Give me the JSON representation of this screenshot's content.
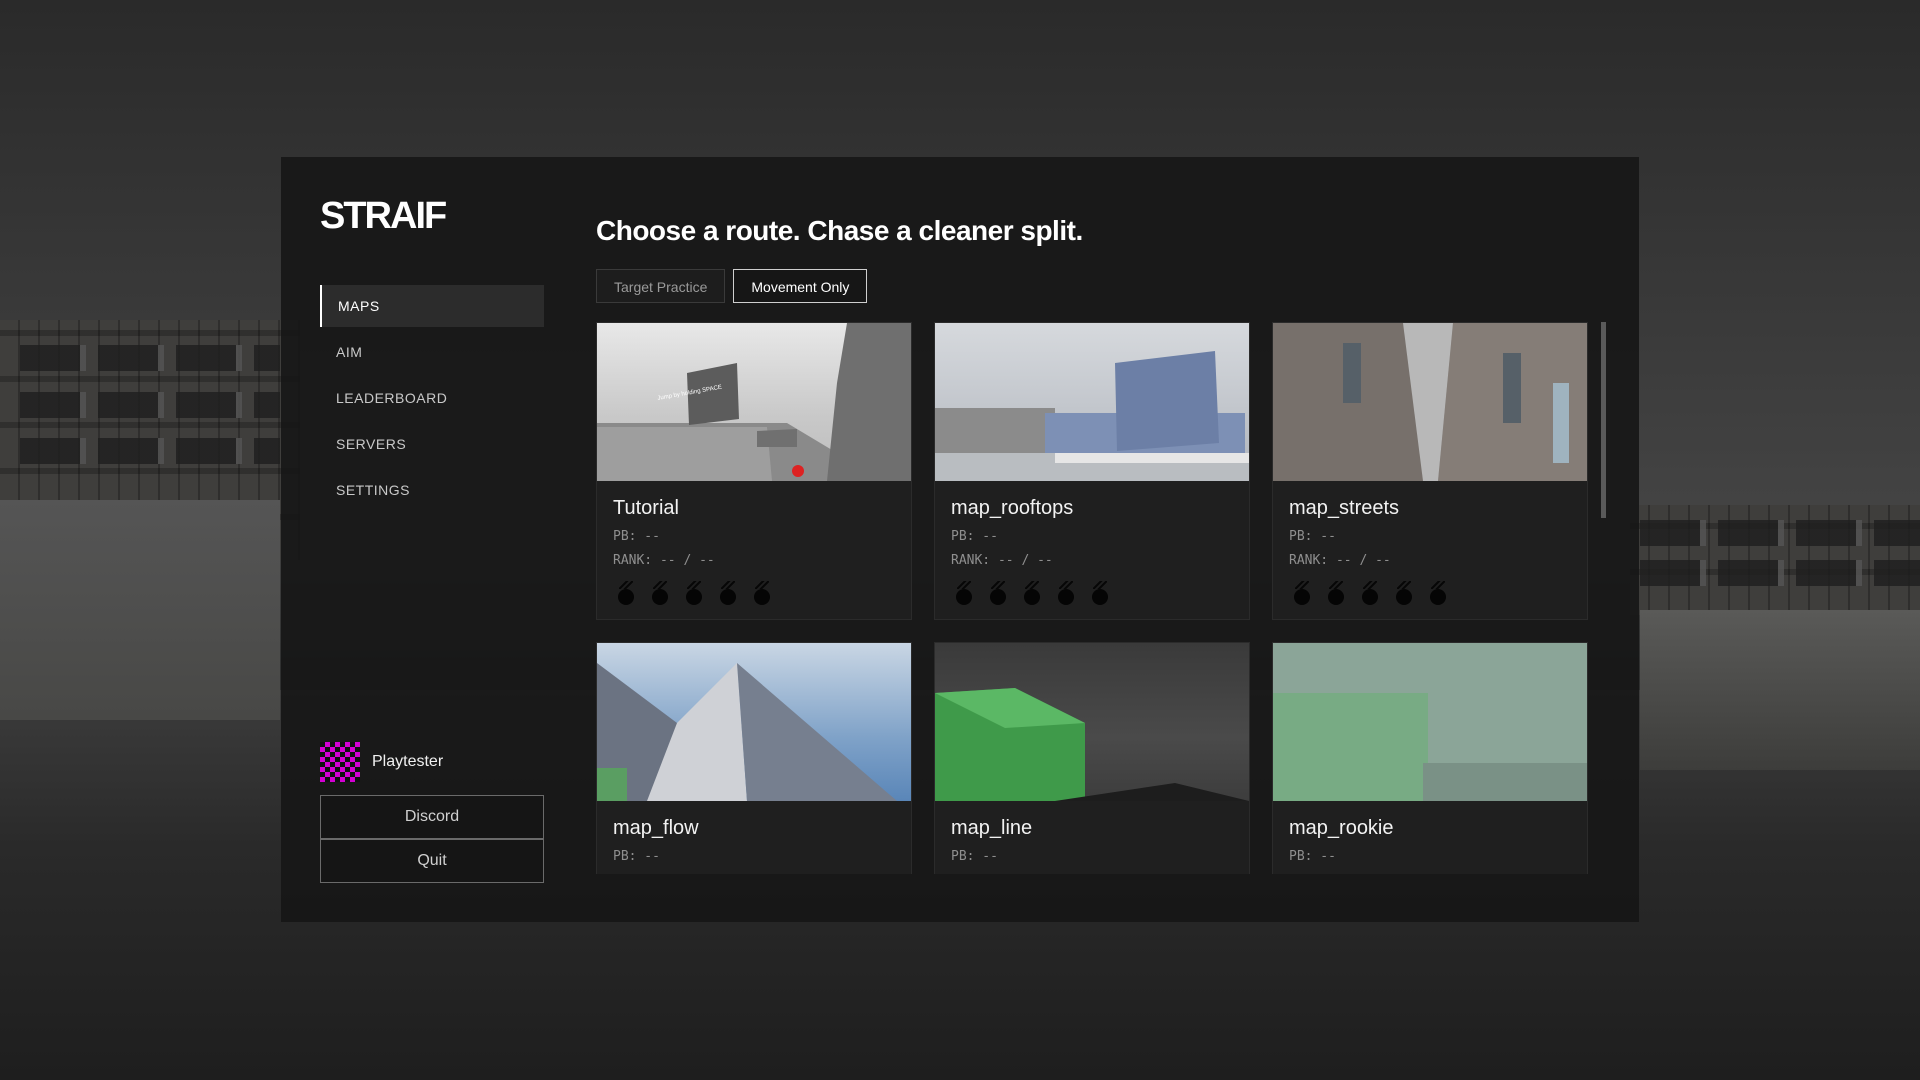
{
  "app": {
    "logo": "STRAIF"
  },
  "sidebar": {
    "nav": [
      {
        "label": "MAPS",
        "active": true
      },
      {
        "label": "AIM",
        "active": false
      },
      {
        "label": "LEADERBOARD",
        "active": false
      },
      {
        "label": "SERVERS",
        "active": false
      },
      {
        "label": "SETTINGS",
        "active": false
      }
    ],
    "user": {
      "name": "Playtester",
      "avatar_color": "#d400d4"
    },
    "discord_label": "Discord",
    "quit_label": "Quit"
  },
  "main": {
    "headline": "Choose a route. Chase a cleaner split.",
    "tabs": [
      {
        "label": "Target Practice",
        "active": false
      },
      {
        "label": "Movement Only",
        "active": true
      }
    ],
    "maps": [
      {
        "name": "Tutorial",
        "pb": "PB: --",
        "rank": "RANK: -- / --",
        "medals": 5,
        "billboard": "Jump by holding SPACE"
      },
      {
        "name": "map_rooftops",
        "pb": "PB: --",
        "rank": "RANK: -- / --",
        "medals": 5
      },
      {
        "name": "map_streets",
        "pb": "PB: --",
        "rank": "RANK: -- / --",
        "medals": 5
      },
      {
        "name": "map_flow",
        "pb": "PB: --"
      },
      {
        "name": "map_line",
        "pb": "PB: --"
      },
      {
        "name": "map_rookie",
        "pb": "PB: --"
      }
    ]
  }
}
